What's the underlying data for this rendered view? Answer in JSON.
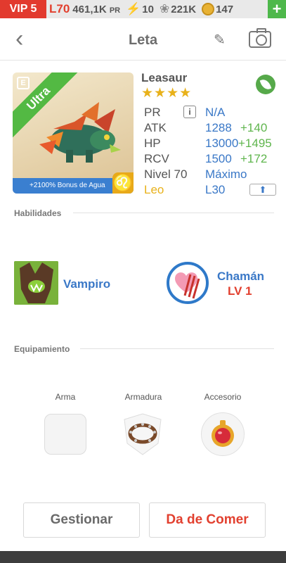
{
  "status": {
    "vip": "VIP 5",
    "level": "L70",
    "power_value": "461,1K",
    "power_unit": "PR",
    "energy": "10",
    "food": "221K",
    "gold": "147",
    "plus": "+"
  },
  "header": {
    "title": "Leta",
    "back": "‹"
  },
  "card": {
    "rarity": "Ultra",
    "badge": "E",
    "bonus": "+2100% Bonus de Agua",
    "sign": "♌"
  },
  "creature": {
    "name": "Leasaur",
    "stars": "★★★★",
    "element": "leaf-icon"
  },
  "stats": {
    "pr_label": "PR",
    "pr_value": "N/A",
    "atk_label": "ATK",
    "atk_value": "1288",
    "atk_bonus": "+140",
    "hp_label": "HP",
    "hp_value": "13000",
    "hp_bonus": "+1495",
    "rcv_label": "RCV",
    "rcv_value": "1500",
    "rcv_bonus": "+172",
    "level_label": "Nivel 70",
    "level_value": "Máximo",
    "sign_label": "Leo",
    "sign_value": "L30"
  },
  "skills": {
    "heading": "Habilidades",
    "skill1": "Vampiro",
    "skill2": "Chamán",
    "skill2_level": "LV 1"
  },
  "equipment": {
    "heading": "Equipamiento",
    "weapon": "Arma",
    "armor": "Armadura",
    "accessory": "Accesorio"
  },
  "actions": {
    "manage": "Gestionar",
    "feed": "Da de Comer"
  },
  "colors": {
    "accent_blue": "#3a78c7",
    "accent_red": "#e2402f",
    "bonus_green": "#5fb54d",
    "rarity_green": "#53b943",
    "star_gold": "#e8b11a"
  }
}
